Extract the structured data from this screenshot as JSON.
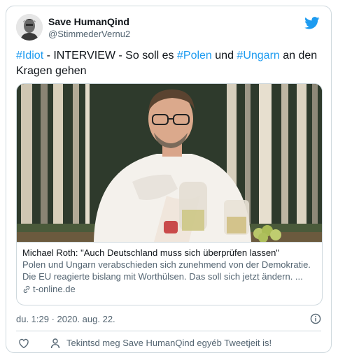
{
  "user": {
    "display_name": "Save HumanQind",
    "handle": "@StimmederVernu2"
  },
  "tweet": {
    "parts": [
      {
        "text": "#Idiot",
        "hashtag": true
      },
      {
        "text": " - INTERVIEW - So soll es ",
        "hashtag": false
      },
      {
        "text": "#Polen",
        "hashtag": true
      },
      {
        "text": " und ",
        "hashtag": false
      },
      {
        "text": "#Ungarn",
        "hashtag": true
      },
      {
        "text": " an den Kragen gehen",
        "hashtag": false
      }
    ]
  },
  "link_card": {
    "title": "Michael Roth: \"Auch Deutschland muss sich überprüfen lassen\"",
    "description": "Polen und Ungarn verabschieden sich zunehmend von der Demokratie. Die EU reagierte bislang mit Worthülsen. Das soll sich jetzt ändern. ...",
    "domain": "t-online.de"
  },
  "timestamp": "du. 1:29 · 2020. aug. 22.",
  "actions": {
    "profile_link": "Tekintsd meg Save HumanQind egyéb Tweetjeit is!"
  },
  "icons": {
    "brand": "twitter-bird-icon",
    "info": "info-icon",
    "like": "heart-icon",
    "profile": "person-icon",
    "link": "link-icon"
  },
  "colors": {
    "accent": "#1d9bf0",
    "text": "#0f1419",
    "secondary": "#536471",
    "border": "#cfd9de"
  }
}
